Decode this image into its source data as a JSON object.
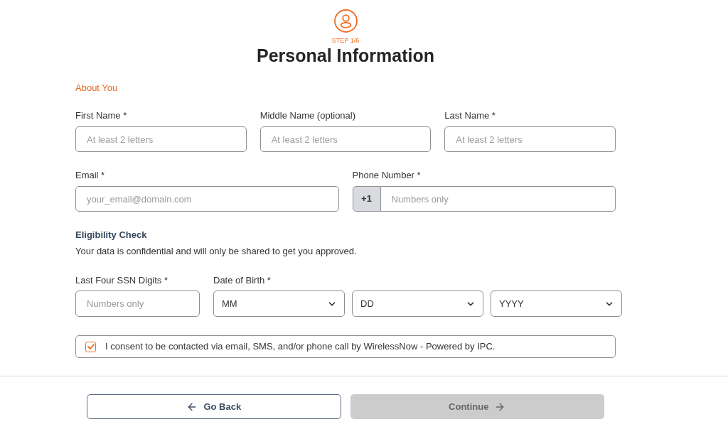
{
  "header": {
    "step": "STEP 1/6",
    "title": "Personal Information"
  },
  "about": {
    "title": "About You",
    "rows": [
      [
        {
          "kind": "text",
          "label": "First Name *",
          "placeholder": "At least 2 letters"
        },
        {
          "kind": "text",
          "label": "Middle Name (optional)",
          "placeholder": "At least 2 letters"
        },
        {
          "kind": "text",
          "label": "Last Name *",
          "placeholder": "At least 2 letters"
        }
      ],
      [
        {
          "kind": "text",
          "label": "Email *",
          "placeholder": "your_email@domain.com"
        },
        {
          "kind": "phone",
          "label": "Phone Number *",
          "prefix": "+1",
          "placeholder": "Numbers only"
        }
      ]
    ]
  },
  "eligibility": {
    "title": "Eligibility Check",
    "subtitle": "Your data is confidential and will only be shared to get you approved.",
    "fields": [
      {
        "kind": "text",
        "label": "Last Four SSN Digits *",
        "placeholder": "Numbers only"
      },
      {
        "kind": "date",
        "label": "Date of Birth *",
        "parts": [
          "MM",
          "DD",
          "YYYY"
        ]
      }
    ]
  },
  "consent": {
    "checked": true,
    "text": "I consent to be contacted via email, SMS, and/or phone call by WirelessNow - Powered by IPC."
  },
  "buttons": [
    {
      "kind": "back",
      "label": "Go Back",
      "disabled": false
    },
    {
      "kind": "continue",
      "label": "Continue",
      "disabled": true
    }
  ]
}
